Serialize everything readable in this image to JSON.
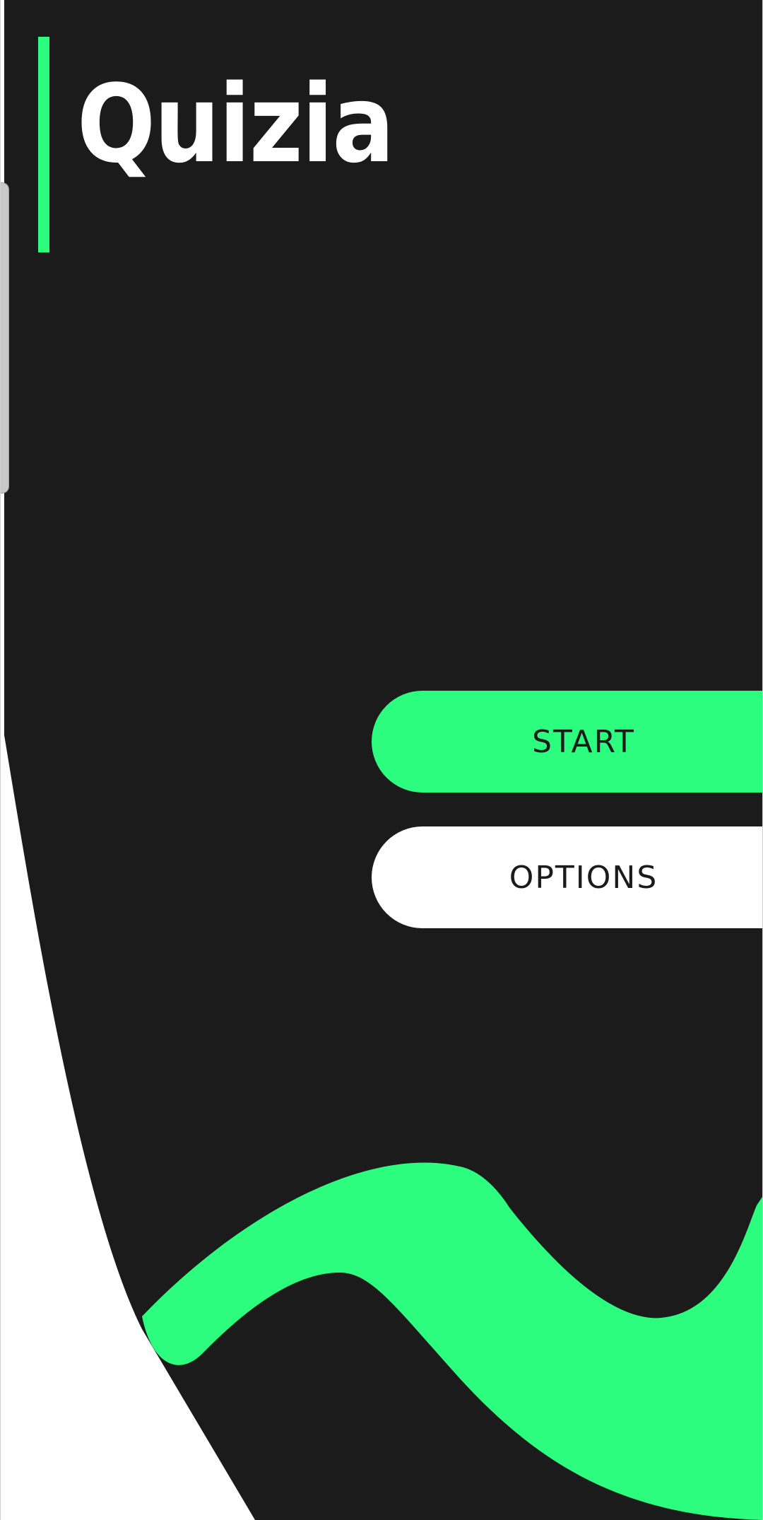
{
  "app": {
    "title": "Quizia"
  },
  "menu": {
    "start_label": "START",
    "options_label": "OPTIONS"
  },
  "theme": {
    "background": "#1B1B1B",
    "accent": "#2DFD7F",
    "surface": "#FFFFFF",
    "text_dark": "#1B1B1B"
  },
  "icons": {
    "edge_handle": "drag-handle-icon"
  }
}
